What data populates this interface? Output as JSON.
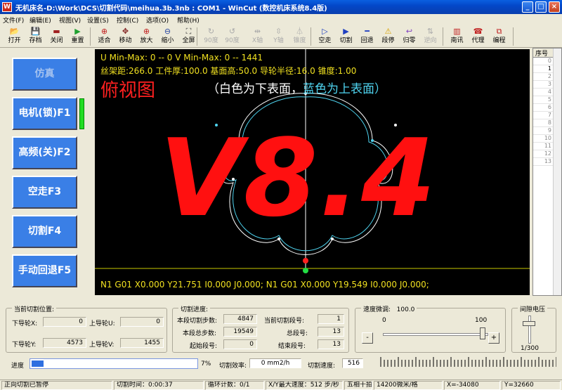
{
  "window": {
    "title": "无机床名-D:\\Work\\DCS\\切割代码\\meihua.3b.3nb : COM1 - WinCut (数控机床系统8.4版)",
    "minimize": "_",
    "maximize": "□",
    "close": "×"
  },
  "menu": [
    "文件(F)",
    "编辑(E)",
    "视图(V)",
    "设置(S)",
    "控制(C)",
    "选项(O)",
    "帮助(H)"
  ],
  "toolbar": [
    {
      "label": "打开",
      "icon": "folder-open-icon",
      "glyph": "📂",
      "enabled": true
    },
    {
      "label": "存档",
      "icon": "save-icon",
      "glyph": "💾",
      "enabled": true
    },
    {
      "label": "关闭",
      "icon": "close-file-icon",
      "glyph": "▬",
      "enabled": true
    },
    {
      "label": "重置",
      "icon": "reset-icon",
      "glyph": "▶",
      "enabled": true
    },
    {
      "label": "适合",
      "icon": "zoom-fit-icon",
      "glyph": "⊕",
      "enabled": true
    },
    {
      "label": "移动",
      "icon": "move-icon",
      "glyph": "✥",
      "enabled": true
    },
    {
      "label": "放大",
      "icon": "zoom-in-icon",
      "glyph": "⊕",
      "enabled": true
    },
    {
      "label": "缩小",
      "icon": "zoom-out-icon",
      "glyph": "⊖",
      "enabled": true
    },
    {
      "label": "全屏",
      "icon": "fullscreen-icon",
      "glyph": "⛶",
      "enabled": true
    },
    {
      "label": "90度",
      "icon": "rotate-cw-icon",
      "glyph": "↻",
      "enabled": false
    },
    {
      "label": "90度",
      "icon": "rotate-ccw-icon",
      "glyph": "↺",
      "enabled": false
    },
    {
      "label": "X轴",
      "icon": "mirror-x-icon",
      "glyph": "⇹",
      "enabled": false
    },
    {
      "label": "Y轴",
      "icon": "mirror-y-icon",
      "glyph": "⇳",
      "enabled": false
    },
    {
      "label": "锥度",
      "icon": "taper-icon",
      "glyph": "⏃",
      "enabled": false
    },
    {
      "label": "空走",
      "icon": "idle-run-icon",
      "glyph": "▷",
      "enabled": true
    },
    {
      "label": "切割",
      "icon": "cut-play-icon",
      "glyph": "▶",
      "enabled": true
    },
    {
      "label": "回退",
      "icon": "back-icon",
      "glyph": "━",
      "enabled": true
    },
    {
      "label": "段停",
      "icon": "segment-stop-icon",
      "glyph": "⚠",
      "enabled": true
    },
    {
      "label": "归零",
      "icon": "home-zero-icon",
      "glyph": "↩",
      "enabled": true
    },
    {
      "label": "逆向",
      "icon": "reverse-icon",
      "glyph": "⇅",
      "enabled": false
    },
    {
      "label": "南讯",
      "icon": "nanxun-icon",
      "glyph": "▥",
      "enabled": true
    },
    {
      "label": "代理",
      "icon": "agent-phone-icon",
      "glyph": "☎",
      "enabled": true
    },
    {
      "label": "编程",
      "icon": "program-icon",
      "glyph": "⧉",
      "enabled": true
    }
  ],
  "left_buttons": [
    {
      "label": "仿真"
    },
    {
      "label": "电机(锁)F1"
    },
    {
      "label": "高频(关)F2"
    },
    {
      "label": "空走F3"
    },
    {
      "label": "切割F4"
    },
    {
      "label": "手动回退F5"
    }
  ],
  "canvas": {
    "line1": "U Min-Max:  0 -- 0   V Min-Max:  0 -- 1441",
    "line2": "丝架距:266.0  工件厚:100.0  基面高:50.0  导轮半径:16.0  锥度:1.00",
    "view_title": "俯视图",
    "note_white": "（白色为下表面，",
    "note_blue": "蓝色为上表面）",
    "watermark": "V8.4",
    "gcode": "N1 G01 X0.000 Y21.751 I0.000 J0.000; N1 G01 X0.000 Y19.549 I0.000 J0.000;",
    "colors": {
      "background": "#000000",
      "info_text": "#f0e020",
      "lower_surface": "#ffffff",
      "upper_surface": "#4fd4f0",
      "watermark": "#ff1010"
    }
  },
  "seq_list": {
    "header": "序号",
    "rows": [
      "0",
      "1",
      "2",
      "3",
      "4",
      "5",
      "6",
      "7",
      "8",
      "9",
      "10",
      "11",
      "12",
      "13"
    ],
    "selected_code": "N1"
  },
  "position_group": {
    "title": "当前切割位置:",
    "lower_x_label": "下导轮X:",
    "lower_x": "0",
    "upper_u_label": "上导轮U:",
    "upper_u": "0",
    "lower_y_label": "下导轮Y:",
    "lower_y": "4573",
    "upper_v_label": "上导轮V:",
    "upper_v": "1455"
  },
  "progress_group": {
    "title": "切割进度:",
    "seg_steps_label": "本段切割步数:",
    "seg_steps": "4847",
    "cur_seg_label": "当前切割段号:",
    "cur_seg": "1",
    "total_steps_label": "本段总步数:",
    "total_steps": "19549",
    "total_seg_label": "总段号:",
    "total_seg": "13",
    "start_seg_label": "起始段号:",
    "start_seg": "0",
    "end_seg_label": "结束段号:",
    "end_seg": "13"
  },
  "speed_group": {
    "title": "速度微调:",
    "value": "100.0",
    "min": "0",
    "max": "100",
    "minus": "-",
    "plus": "+",
    "slider_fraction": 1.0
  },
  "gap_group": {
    "title": "间隙电压",
    "value": "1/300"
  },
  "progress": {
    "label": "进度",
    "percent": 7,
    "percent_text": "7%",
    "efficiency_label": "切割效率:",
    "efficiency": "0 mm2/h",
    "speed_label": "切割速度:",
    "speed": "516"
  },
  "status": [
    "正向切割已暂停",
    "切割时间：0:00:37",
    "循环计数：0/1",
    "X/Y最大速度：512 步/秒",
    "五相十拍",
    "14200微米/格",
    "X=-34080",
    "Y=32660"
  ]
}
